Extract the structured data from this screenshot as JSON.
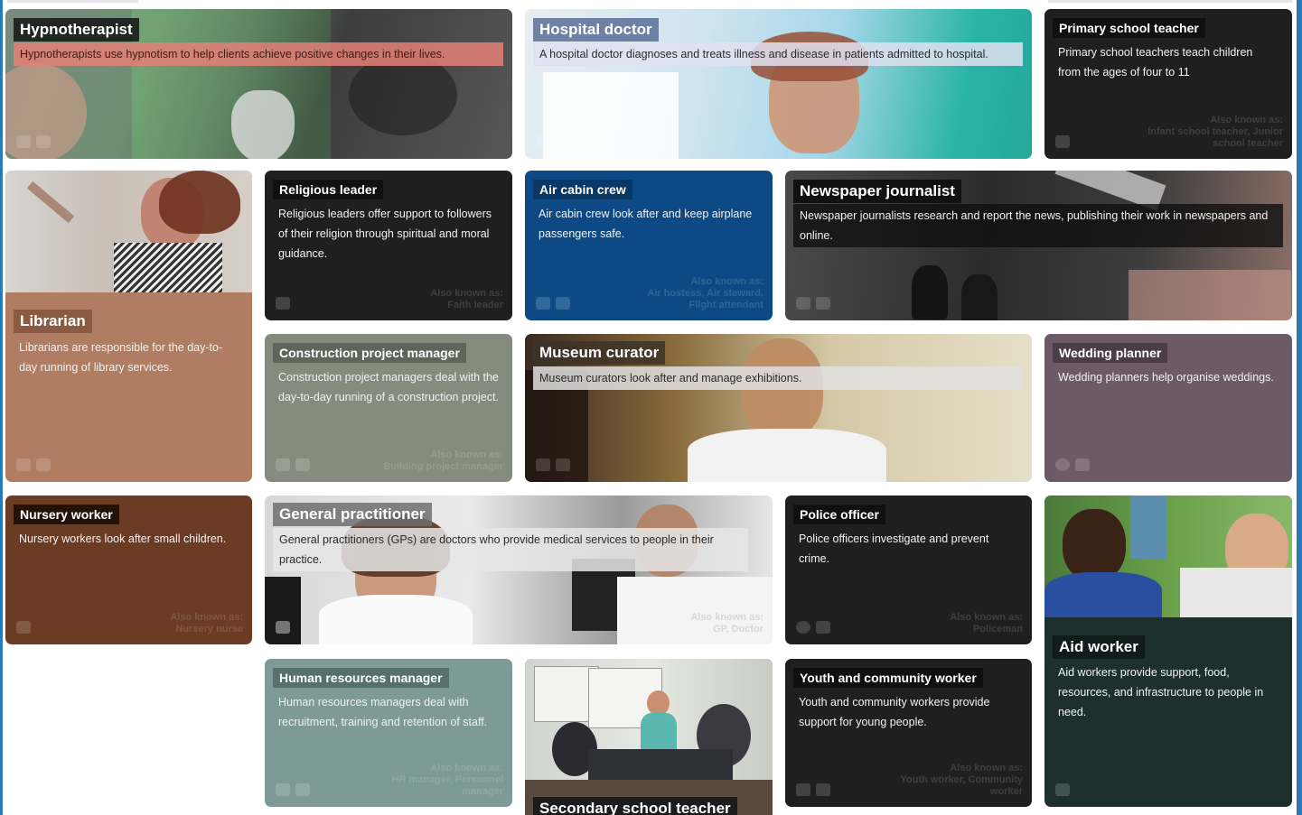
{
  "cards": {
    "hypnotherapist": {
      "title": "Hypnotherapist",
      "description": "Hypnotherapists use hypnotism to help clients achieve positive changes in their lives."
    },
    "hospital_doctor": {
      "title": "Hospital doctor",
      "description": "A hospital doctor diagnoses and treats illness and disease in patients admitted to hospital."
    },
    "primary_school_teacher": {
      "title": "Primary school teacher",
      "description": "Primary school teachers teach children from the ages of four to 11",
      "also_known_as_label": "Also known as:",
      "also_known_as": "Infant school teacher, Junior school teacher"
    },
    "librarian": {
      "title": "Librarian",
      "description": "Librarians are responsible for the day-to-day running of library services."
    },
    "religious_leader": {
      "title": "Religious leader",
      "description": "Religious leaders offer support to followers of their religion through spiritual and moral guidance.",
      "also_known_as_label": "Also known as:",
      "also_known_as": "Faith leader"
    },
    "air_cabin_crew": {
      "title": "Air cabin crew",
      "description": "Air cabin crew look after and keep airplane passengers safe.",
      "also_known_as_label": "Also known as:",
      "also_known_as": "Air hostess, Air steward, Flight attendant"
    },
    "newspaper_journalist": {
      "title": "Newspaper journalist",
      "description": "Newspaper journalists research and report the news, publishing their work in newspapers and online."
    },
    "construction_project_manager": {
      "title": "Construction project manager",
      "description": "Construction project managers deal with the day-to-day running of a construction project.",
      "also_known_as_label": "Also known as:",
      "also_known_as": "Building project manager"
    },
    "museum_curator": {
      "title": "Museum curator",
      "description": "Museum curators look after and manage exhibitions."
    },
    "wedding_planner": {
      "title": "Wedding planner",
      "description": "Wedding planners help organise weddings."
    },
    "nursery_worker": {
      "title": "Nursery worker",
      "description": "Nursery workers look after small children.",
      "also_known_as_label": "Also known as:",
      "also_known_as": "Nursery nurse"
    },
    "general_practitioner": {
      "title": "General practitioner",
      "description": "General practitioners (GPs) are doctors who provide medical services to people in their practice.",
      "also_known_as_label": "Also known as:",
      "also_known_as": "GP, Doctor"
    },
    "police_officer": {
      "title": "Police officer",
      "description": "Police officers investigate and prevent crime.",
      "also_known_as_label": "Also known as:",
      "also_known_as": "Policeman"
    },
    "aid_worker": {
      "title": "Aid worker",
      "description": "Aid workers provide support, food, resources, and infrastructure to people in need."
    },
    "human_resources_manager": {
      "title": "Human resources manager",
      "description": "Human resources managers deal with recruitment, training and retention of staff.",
      "also_known_as_label": "Also known as:",
      "also_known_as": "HR manager, Personnel manager"
    },
    "secondary_school_teacher": {
      "title": "Secondary school teacher"
    },
    "youth_community_worker": {
      "title": "Youth and community worker",
      "description": "Youth and community workers provide support for young people.",
      "also_known_as_label": "Also known as:",
      "also_known_as": "Youth worker, Community worker"
    }
  },
  "colors": {
    "dark_card": "#1f1f1f",
    "blue_card": "#0d4a85",
    "librarian_card": "#b07c62",
    "sage_card": "#858c7e",
    "mauve_card": "#6c5a68",
    "brown_card": "#6b3c23",
    "teal_card": "#7d9998",
    "aid_card": "#1d302d",
    "frame_blue": "#2a7ab7"
  }
}
